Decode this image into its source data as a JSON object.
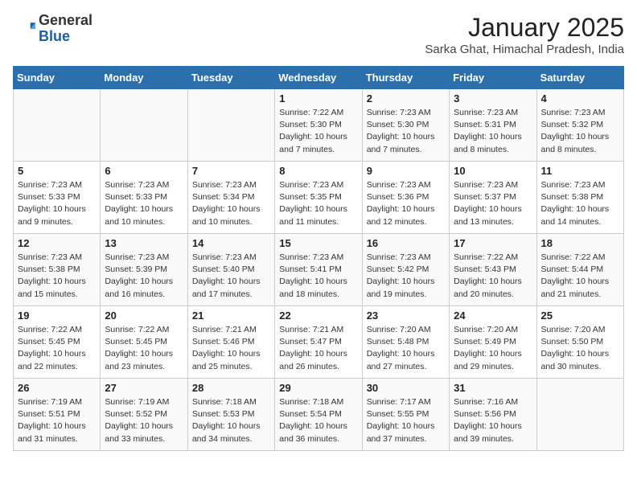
{
  "header": {
    "logo_general": "General",
    "logo_blue": "Blue",
    "title": "January 2025",
    "subtitle": "Sarka Ghat, Himachal Pradesh, India"
  },
  "days_of_week": [
    "Sunday",
    "Monday",
    "Tuesday",
    "Wednesday",
    "Thursday",
    "Friday",
    "Saturday"
  ],
  "weeks": [
    [
      {
        "day": "",
        "info": ""
      },
      {
        "day": "",
        "info": ""
      },
      {
        "day": "",
        "info": ""
      },
      {
        "day": "1",
        "info": "Sunrise: 7:22 AM\nSunset: 5:30 PM\nDaylight: 10 hours\nand 7 minutes."
      },
      {
        "day": "2",
        "info": "Sunrise: 7:23 AM\nSunset: 5:30 PM\nDaylight: 10 hours\nand 7 minutes."
      },
      {
        "day": "3",
        "info": "Sunrise: 7:23 AM\nSunset: 5:31 PM\nDaylight: 10 hours\nand 8 minutes."
      },
      {
        "day": "4",
        "info": "Sunrise: 7:23 AM\nSunset: 5:32 PM\nDaylight: 10 hours\nand 8 minutes."
      }
    ],
    [
      {
        "day": "5",
        "info": "Sunrise: 7:23 AM\nSunset: 5:33 PM\nDaylight: 10 hours\nand 9 minutes."
      },
      {
        "day": "6",
        "info": "Sunrise: 7:23 AM\nSunset: 5:33 PM\nDaylight: 10 hours\nand 10 minutes."
      },
      {
        "day": "7",
        "info": "Sunrise: 7:23 AM\nSunset: 5:34 PM\nDaylight: 10 hours\nand 10 minutes."
      },
      {
        "day": "8",
        "info": "Sunrise: 7:23 AM\nSunset: 5:35 PM\nDaylight: 10 hours\nand 11 minutes."
      },
      {
        "day": "9",
        "info": "Sunrise: 7:23 AM\nSunset: 5:36 PM\nDaylight: 10 hours\nand 12 minutes."
      },
      {
        "day": "10",
        "info": "Sunrise: 7:23 AM\nSunset: 5:37 PM\nDaylight: 10 hours\nand 13 minutes."
      },
      {
        "day": "11",
        "info": "Sunrise: 7:23 AM\nSunset: 5:38 PM\nDaylight: 10 hours\nand 14 minutes."
      }
    ],
    [
      {
        "day": "12",
        "info": "Sunrise: 7:23 AM\nSunset: 5:38 PM\nDaylight: 10 hours\nand 15 minutes."
      },
      {
        "day": "13",
        "info": "Sunrise: 7:23 AM\nSunset: 5:39 PM\nDaylight: 10 hours\nand 16 minutes."
      },
      {
        "day": "14",
        "info": "Sunrise: 7:23 AM\nSunset: 5:40 PM\nDaylight: 10 hours\nand 17 minutes."
      },
      {
        "day": "15",
        "info": "Sunrise: 7:23 AM\nSunset: 5:41 PM\nDaylight: 10 hours\nand 18 minutes."
      },
      {
        "day": "16",
        "info": "Sunrise: 7:23 AM\nSunset: 5:42 PM\nDaylight: 10 hours\nand 19 minutes."
      },
      {
        "day": "17",
        "info": "Sunrise: 7:22 AM\nSunset: 5:43 PM\nDaylight: 10 hours\nand 20 minutes."
      },
      {
        "day": "18",
        "info": "Sunrise: 7:22 AM\nSunset: 5:44 PM\nDaylight: 10 hours\nand 21 minutes."
      }
    ],
    [
      {
        "day": "19",
        "info": "Sunrise: 7:22 AM\nSunset: 5:45 PM\nDaylight: 10 hours\nand 22 minutes."
      },
      {
        "day": "20",
        "info": "Sunrise: 7:22 AM\nSunset: 5:45 PM\nDaylight: 10 hours\nand 23 minutes."
      },
      {
        "day": "21",
        "info": "Sunrise: 7:21 AM\nSunset: 5:46 PM\nDaylight: 10 hours\nand 25 minutes."
      },
      {
        "day": "22",
        "info": "Sunrise: 7:21 AM\nSunset: 5:47 PM\nDaylight: 10 hours\nand 26 minutes."
      },
      {
        "day": "23",
        "info": "Sunrise: 7:20 AM\nSunset: 5:48 PM\nDaylight: 10 hours\nand 27 minutes."
      },
      {
        "day": "24",
        "info": "Sunrise: 7:20 AM\nSunset: 5:49 PM\nDaylight: 10 hours\nand 29 minutes."
      },
      {
        "day": "25",
        "info": "Sunrise: 7:20 AM\nSunset: 5:50 PM\nDaylight: 10 hours\nand 30 minutes."
      }
    ],
    [
      {
        "day": "26",
        "info": "Sunrise: 7:19 AM\nSunset: 5:51 PM\nDaylight: 10 hours\nand 31 minutes."
      },
      {
        "day": "27",
        "info": "Sunrise: 7:19 AM\nSunset: 5:52 PM\nDaylight: 10 hours\nand 33 minutes."
      },
      {
        "day": "28",
        "info": "Sunrise: 7:18 AM\nSunset: 5:53 PM\nDaylight: 10 hours\nand 34 minutes."
      },
      {
        "day": "29",
        "info": "Sunrise: 7:18 AM\nSunset: 5:54 PM\nDaylight: 10 hours\nand 36 minutes."
      },
      {
        "day": "30",
        "info": "Sunrise: 7:17 AM\nSunset: 5:55 PM\nDaylight: 10 hours\nand 37 minutes."
      },
      {
        "day": "31",
        "info": "Sunrise: 7:16 AM\nSunset: 5:56 PM\nDaylight: 10 hours\nand 39 minutes."
      },
      {
        "day": "",
        "info": ""
      }
    ]
  ]
}
